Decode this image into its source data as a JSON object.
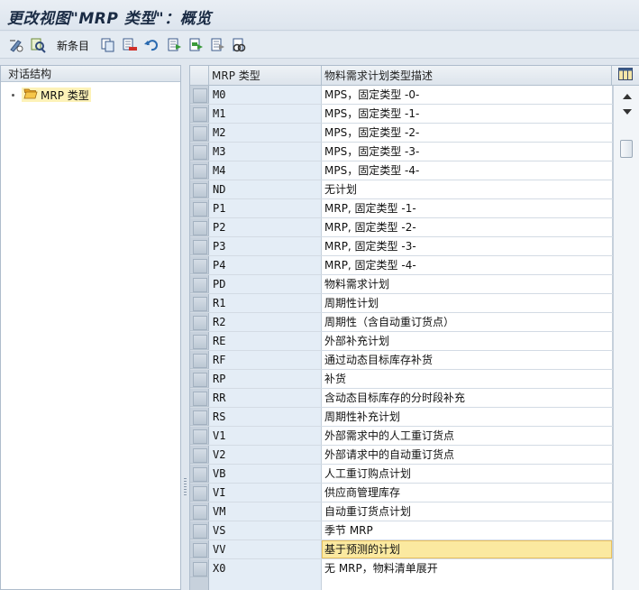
{
  "window": {
    "title": "更改视图\"MRP 类型\"：概览"
  },
  "toolbar": {
    "new_entries_label": "新条目",
    "icons": [
      "edit-display-icon",
      "find-icon",
      "copy-icon",
      "delete-icon",
      "undo-icon",
      "select-all-icon",
      "select-block-icon",
      "deselect-all-icon",
      "other-icon"
    ]
  },
  "left_pane": {
    "title": "对话结构",
    "tree": [
      {
        "label": "MRP 类型",
        "icon": "folder-open-icon"
      }
    ]
  },
  "table": {
    "columns": {
      "code": "MRP 类型",
      "description": "物料需求计划类型描述"
    },
    "rows": [
      {
        "code": "M0",
        "desc": "MPS，固定类型 -0-"
      },
      {
        "code": "M1",
        "desc": "MPS，固定类型 -1-"
      },
      {
        "code": "M2",
        "desc": "MPS，固定类型 -2-"
      },
      {
        "code": "M3",
        "desc": "MPS，固定类型 -3-"
      },
      {
        "code": "M4",
        "desc": "MPS，固定类型 -4-"
      },
      {
        "code": "ND",
        "desc": "无计划"
      },
      {
        "code": "P1",
        "desc": "MRP, 固定类型 -1-"
      },
      {
        "code": "P2",
        "desc": "MRP, 固定类型 -2-"
      },
      {
        "code": "P3",
        "desc": "MRP, 固定类型 -3-"
      },
      {
        "code": "P4",
        "desc": "MRP, 固定类型 -4-"
      },
      {
        "code": "PD",
        "desc": "物料需求计划"
      },
      {
        "code": "R1",
        "desc": "周期性计划"
      },
      {
        "code": "R2",
        "desc": "周期性（含自动重订货点）"
      },
      {
        "code": "RE",
        "desc": "外部补充计划"
      },
      {
        "code": "RF",
        "desc": "通过动态目标库存补货"
      },
      {
        "code": "RP",
        "desc": "补货"
      },
      {
        "code": "RR",
        "desc": "含动态目标库存的分时段补充"
      },
      {
        "code": "RS",
        "desc": "周期性补充计划"
      },
      {
        "code": "V1",
        "desc": "外部需求中的人工重订货点"
      },
      {
        "code": "V2",
        "desc": "外部请求中的自动重订货点"
      },
      {
        "code": "VB",
        "desc": "人工重订购点计划"
      },
      {
        "code": "VI",
        "desc": "供应商管理库存"
      },
      {
        "code": "VM",
        "desc": "自动重订货点计划"
      },
      {
        "code": "VS",
        "desc": "季节 MRP"
      },
      {
        "code": "VV",
        "desc": "基于预测的计划"
      },
      {
        "code": "X0",
        "desc": "无 MRP，物料清单展开"
      }
    ],
    "active_row_index": 24
  },
  "colors": {
    "active_cell": "#fbe9a0",
    "code_column": "#e4edf6",
    "folder": "#f0b030"
  }
}
